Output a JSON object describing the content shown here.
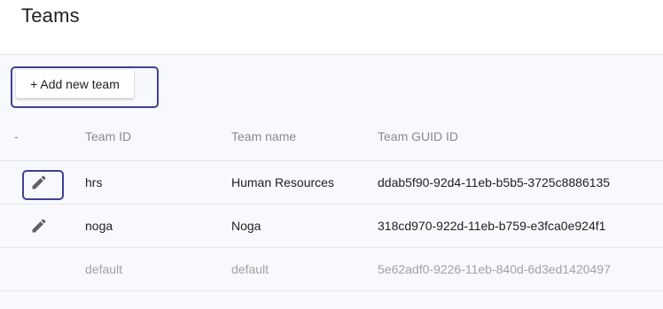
{
  "page": {
    "title": "Teams"
  },
  "toolbar": {
    "add_label": "+ Add new team"
  },
  "table": {
    "columns": [
      "-",
      "Team ID",
      "Team name",
      "Team GUID ID"
    ],
    "rows": [
      {
        "id": "hrs",
        "name": "Human Resources",
        "guid": "ddab5f90-92d4-11eb-b5b5-3725c8886135",
        "editable": true
      },
      {
        "id": "noga",
        "name": "Noga",
        "guid": "318cd970-922d-11eb-b759-e3fca0e924f1",
        "editable": true
      },
      {
        "id": "default",
        "name": "default",
        "guid": "5e62adf0-9226-11eb-840d-6d3ed1420497",
        "editable": false
      }
    ]
  },
  "icons": {
    "edit": "pencil-icon"
  },
  "colors": {
    "focus_ring": "#3f3f9a",
    "icon": "#616161",
    "muted_text": "#a2a2a2"
  }
}
